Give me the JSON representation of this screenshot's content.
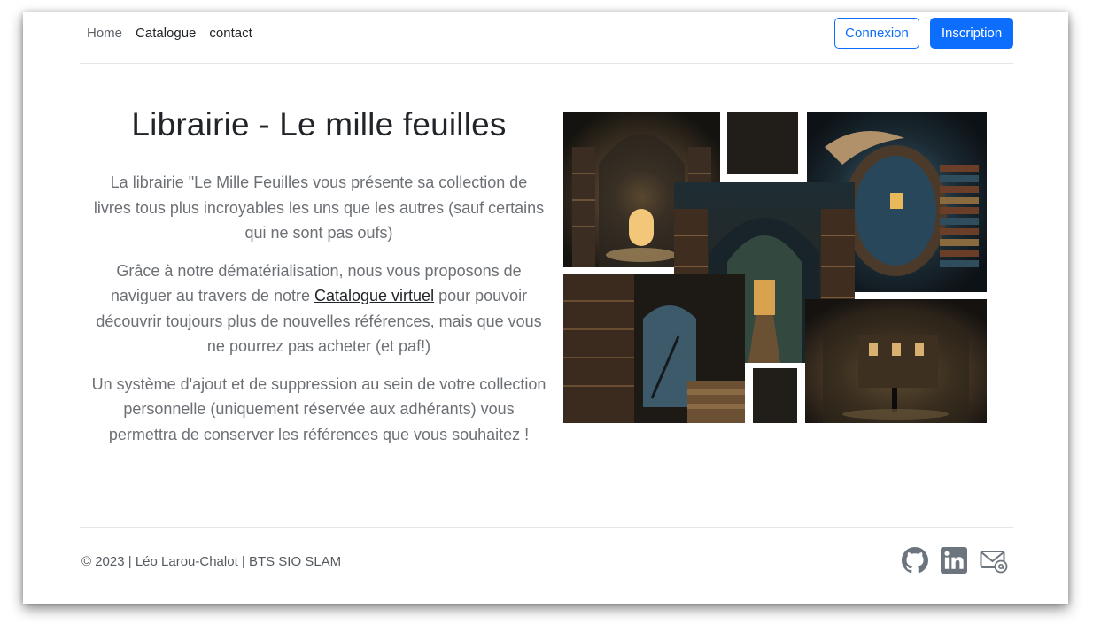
{
  "nav": {
    "links": [
      "Home",
      "Catalogue",
      "contact"
    ],
    "login_label": "Connexion",
    "signup_label": "Inscription"
  },
  "hero": {
    "title": "Librairie - Le mille feuilles",
    "p1": "La librairie \"Le Mille Feuilles vous présente sa collection de livres tous plus incroyables les uns que les autres (sauf certains qui ne sont pas oufs)",
    "p2_before": "Grâce à notre dématérialisation, nous vous proposons de naviguer au travers de notre ",
    "p2_link": "Catalogue virtuel",
    "p2_after": " pour pouvoir découvrir toujours plus de nouvelles références, mais que vous ne pourrez pas acheter (et paf!)",
    "p3": "Un système d'ajout et de suppression au sein de votre collection personnelle (uniquement réservée aux adhérants) vous permettra de conserver les références que vous souhaitez !"
  },
  "footer": {
    "copyright": "© 2023 | Léo Larou-Chalot | BTS SIO SLAM",
    "icons": [
      "github-icon",
      "linkedin-icon",
      "mail-icon"
    ]
  },
  "colors": {
    "primary": "#0d6efd",
    "text_muted": "#6c7075",
    "dark_block": "#211d18"
  }
}
